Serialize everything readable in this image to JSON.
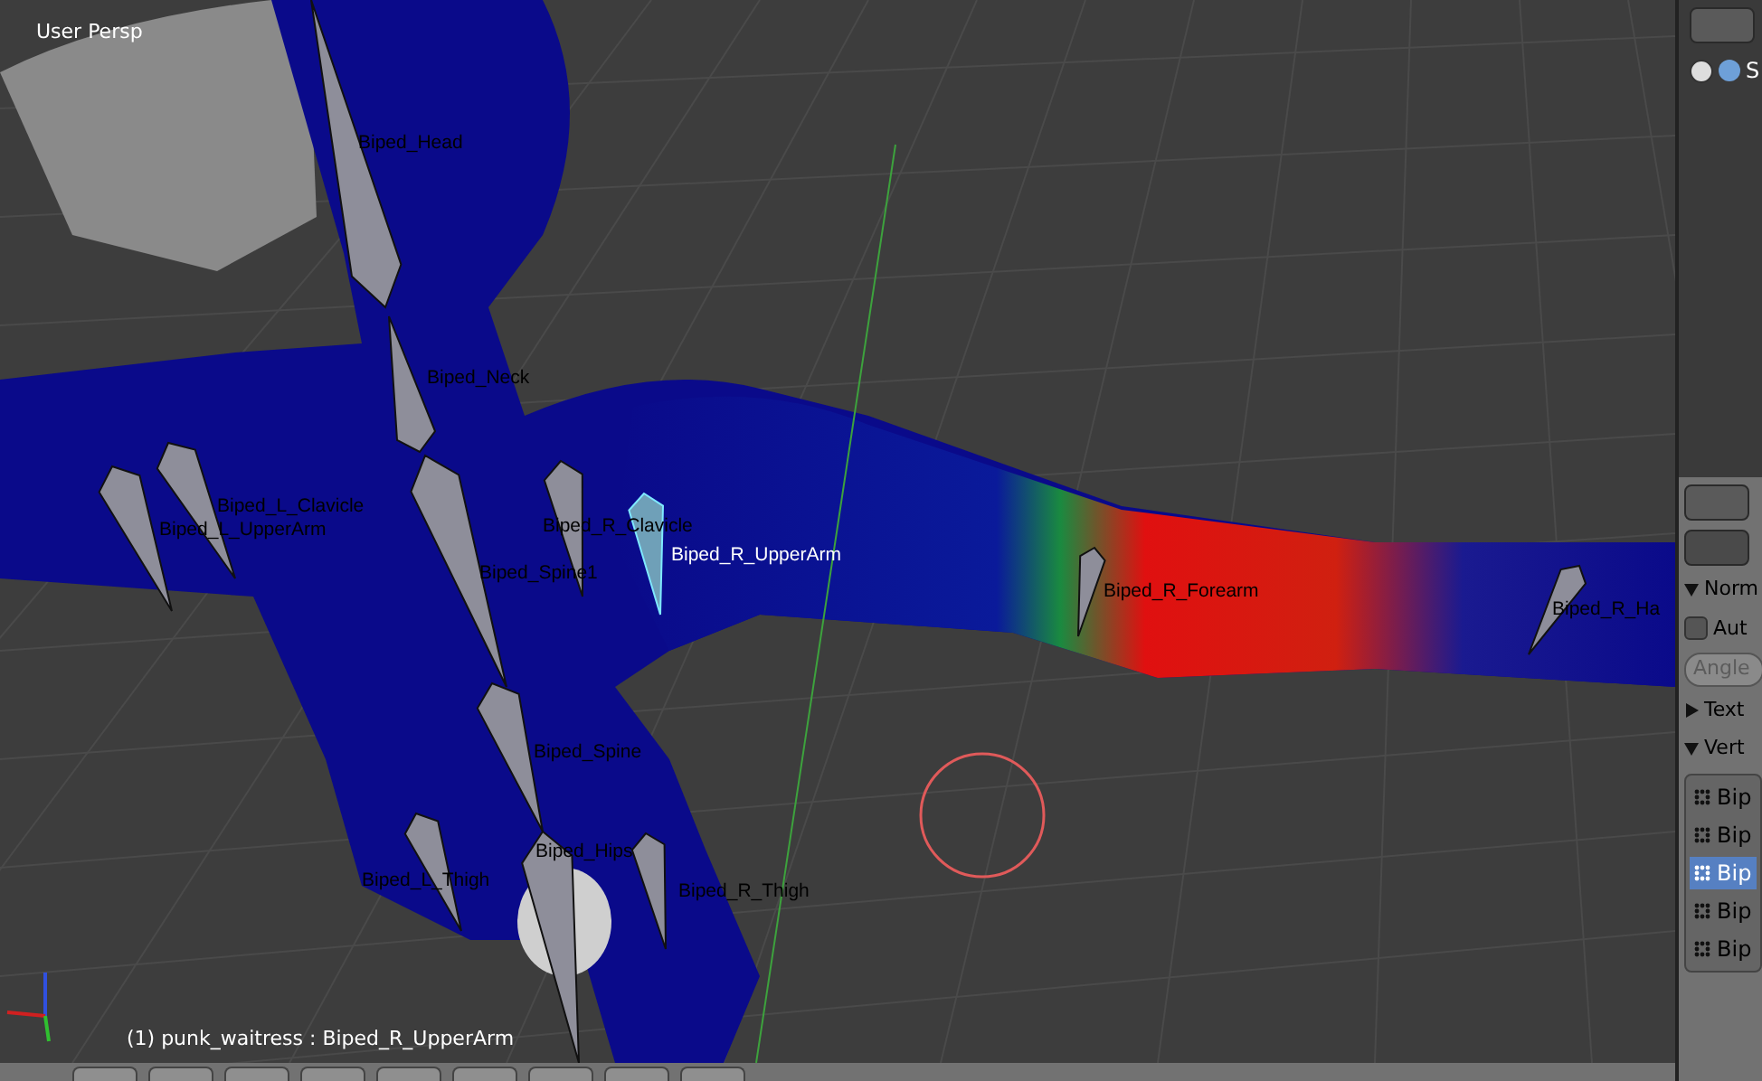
{
  "viewport": {
    "view_label": "User Persp",
    "bones": [
      {
        "label": "Biped_Head",
        "selected": false
      },
      {
        "label": "Biped_Neck",
        "selected": false
      },
      {
        "label": "Biped_L_Clavicle",
        "selected": false
      },
      {
        "label": "Biped_L_UpperArm",
        "selected": false
      },
      {
        "label": "Biped_R_Clavicle",
        "selected": false
      },
      {
        "label": "Biped_R_UpperArm",
        "selected": true
      },
      {
        "label": "Biped_Spine1",
        "selected": false
      },
      {
        "label": "Biped_R_Forearm",
        "selected": false
      },
      {
        "label": "Biped_R_Ha",
        "selected": false
      },
      {
        "label": "Biped_Spine",
        "selected": false
      },
      {
        "label": "Biped_L_Thigh",
        "selected": false
      },
      {
        "label": "Biped_Hips",
        "selected": false
      },
      {
        "label": "Biped_R_Thigh",
        "selected": false
      }
    ],
    "status": "(1) punk_waitress : Biped_R_UpperArm"
  },
  "outliner": {
    "root_label": "S"
  },
  "properties": {
    "panels": [
      {
        "title": "Norm",
        "expanded": true
      },
      {
        "title": "Text",
        "expanded": false
      },
      {
        "title": "Vert",
        "expanded": true
      }
    ],
    "auto_checkbox": {
      "label": "Aut",
      "checked": false
    },
    "angle_field": {
      "label": "Angle",
      "disabled": true
    },
    "vertex_groups": [
      {
        "label": "Bip",
        "selected": false
      },
      {
        "label": "Bip",
        "selected": false
      },
      {
        "label": "Bip",
        "selected": true
      },
      {
        "label": "Bip",
        "selected": false
      },
      {
        "label": "Bip",
        "selected": false
      }
    ]
  }
}
